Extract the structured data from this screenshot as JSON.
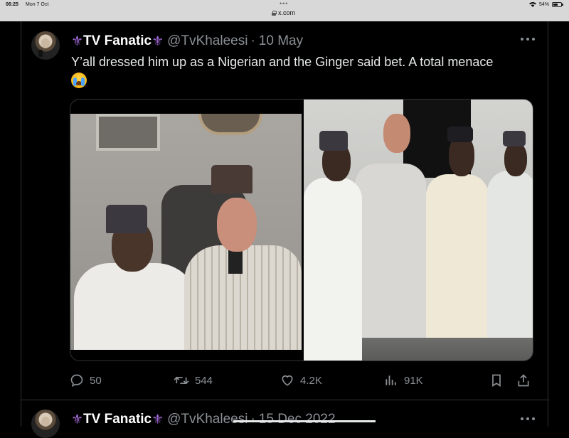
{
  "status_bar": {
    "time": "06:25",
    "date": "Mon 7 Oct",
    "url": "x.com",
    "battery": "54%"
  },
  "tweet": {
    "display_name": "TV Fanatic",
    "handle": "@TvKhaleesi",
    "separator": "·",
    "date": "10 May",
    "text": "Y’all dressed him up as a Nigerian and the Ginger said bet. A total menace",
    "emoji": "loudly-crying-face-emoji",
    "media": [
      "photo-left",
      "photo-right"
    ],
    "stats": {
      "replies": "50",
      "reposts": "544",
      "likes": "4.2K",
      "views": "91K"
    }
  },
  "next_tweet": {
    "display_name": "TV Fanatic",
    "handle": "@TvKhaleesi",
    "separator": "·",
    "date": "15 Dec 2022"
  },
  "colors": {
    "background": "#000000",
    "text_primary": "#e7e9ea",
    "text_secondary": "#8b9095",
    "fleur": "#a26bd8",
    "border": "#2f3336"
  },
  "icons": [
    "fleur-de-lis-icon",
    "more-icon",
    "reply-icon",
    "retweet-icon",
    "like-icon",
    "views-icon",
    "bookmark-icon",
    "share-icon",
    "lock-icon",
    "wifi-icon",
    "battery-icon"
  ]
}
